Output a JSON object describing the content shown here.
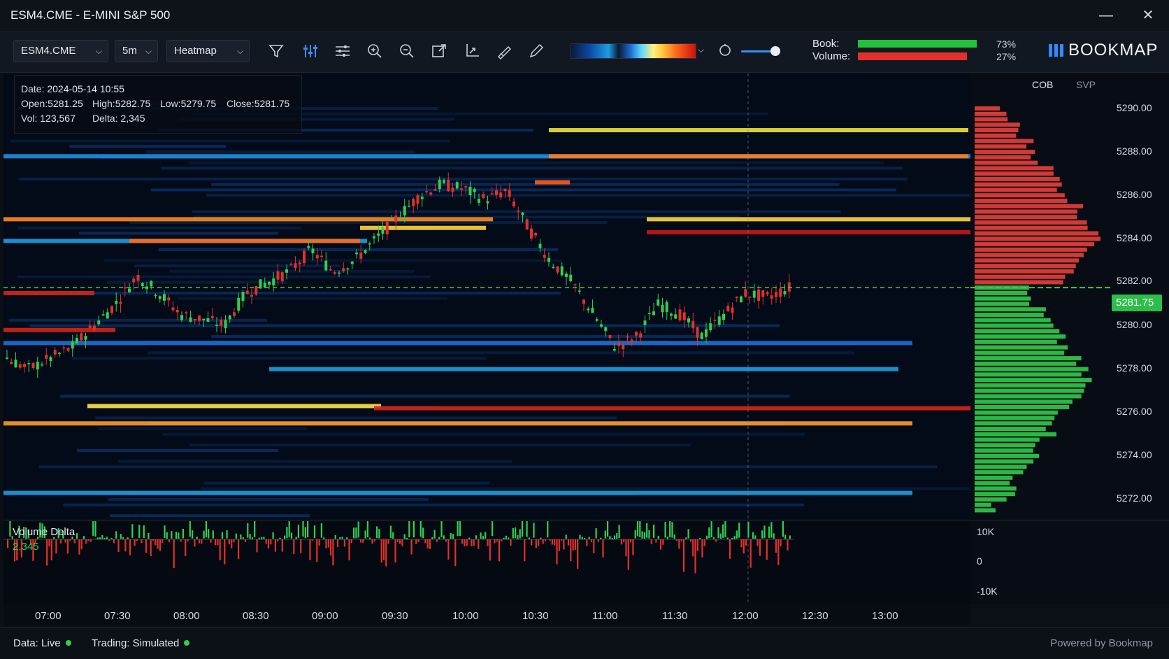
{
  "window": {
    "title": "ESM4.CME - E-MINI S&P 500",
    "minimize_glyph": "—",
    "close_glyph": "✕"
  },
  "toolbar": {
    "instrument": "ESM4.CME",
    "timeframe": "5m",
    "view_mode": "Heatmap",
    "tools": [
      "filter-icon",
      "indicators-icon",
      "layers-icon",
      "zoom-in-icon",
      "zoom-out-icon",
      "expand-icon",
      "crop-icon",
      "line-draw-icon",
      "pencil-icon"
    ],
    "colormap_icons": [
      "color-gradient",
      "chevron-down-icon",
      "settings-circle-icon",
      "brightness-slider"
    ],
    "book_label": "Book:",
    "volume_label": "Volume:",
    "book_pct": "73%",
    "volume_pct": "27%",
    "book_fraction": 0.73,
    "volume_fraction": 0.27,
    "brand": "BOOKMAP"
  },
  "info": {
    "date_label": "Date:",
    "date": "2024-05-14 10:55",
    "open_label": "Open:",
    "open": "5281.25",
    "high_label": "High:",
    "high": "5282.75",
    "low_label": "Low:",
    "low": "5279.75",
    "close_label": "Close:",
    "close": "5281.75",
    "vol_label": "Vol:",
    "vol": "123,567",
    "delta_label": "Delta:",
    "delta": "2,345"
  },
  "panel": {
    "tab_cob": "COB",
    "tab_svp": "SVP",
    "current_price": "5281.75"
  },
  "price_axis": [
    "5290.00",
    "5288.00",
    "5286.00",
    "5284.00",
    "5282.00",
    "5280.00",
    "5278.00",
    "5276.00",
    "5274.00",
    "5272.00"
  ],
  "volume_delta": {
    "label": "Volume Delta",
    "value": "2,345",
    "scale": [
      "10K",
      "0",
      "-10K"
    ]
  },
  "time_axis": [
    "07:00",
    "07:30",
    "08:00",
    "08:30",
    "09:00",
    "09:30",
    "10:00",
    "10:30",
    "11:00",
    "11:30",
    "12:00",
    "12:30",
    "13:00"
  ],
  "status": {
    "data": "Data: Live",
    "trading": "Trading: Simulated",
    "powered": "Powered by Bookmap"
  },
  "colors": {
    "bid": "#22c33b",
    "ask": "#e2312b",
    "accent": "#2f8cff"
  }
}
